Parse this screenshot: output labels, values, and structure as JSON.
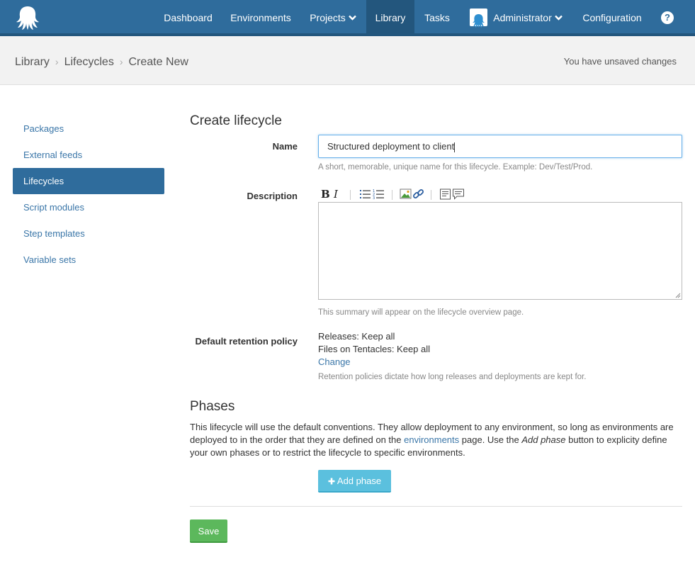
{
  "nav": {
    "items": [
      {
        "label": "Dashboard"
      },
      {
        "label": "Environments"
      },
      {
        "label": "Projects"
      },
      {
        "label": "Library"
      },
      {
        "label": "Tasks"
      },
      {
        "label": "Administrator"
      },
      {
        "label": "Configuration"
      }
    ],
    "help_label": "?"
  },
  "breadcrumb": {
    "items": [
      "Library",
      "Lifecycles",
      "Create New"
    ],
    "separator": "›",
    "status": "You have unsaved changes"
  },
  "sidebar": {
    "items": [
      {
        "label": "Packages"
      },
      {
        "label": "External feeds"
      },
      {
        "label": "Lifecycles"
      },
      {
        "label": "Script modules"
      },
      {
        "label": "Step templates"
      },
      {
        "label": "Variable sets"
      }
    ]
  },
  "form": {
    "title": "Create lifecycle",
    "name_label": "Name",
    "name_value": "Structured deployment to client",
    "name_hint": "A short, memorable, unique name for this lifecycle. Example: Dev/Test/Prod.",
    "description_label": "Description",
    "description_value": "",
    "description_hint": "This summary will appear on the lifecycle overview page.",
    "retention_label": "Default retention policy",
    "retention_releases": "Releases: Keep all",
    "retention_files": "Files on Tentacles: Keep all",
    "retention_change": "Change",
    "retention_hint": "Retention policies dictate how long releases and deployments are kept for."
  },
  "phases": {
    "title": "Phases",
    "text_1": "This lifecycle will use the default conventions. They allow deployment to any environment, so long as environments are deployed to in the order that they are defined on the ",
    "link": "environments",
    "text_2": " page. Use the ",
    "emphasis": "Add phase",
    "text_3": " button to explicity define your own phases or to restrict the lifecycle to specific environments.",
    "add_button": "Add phase"
  },
  "save_label": "Save",
  "colors": {
    "nav_bg": "#2f6c9c",
    "nav_active": "#23567d",
    "link": "#3a76a8",
    "add_button": "#5bc0de",
    "save_button": "#5cb85c"
  },
  "icons": [
    "octopus-logo-icon",
    "chevron-down-icon",
    "user-avatar-icon",
    "help-icon",
    "bold-icon",
    "italic-icon",
    "bullet-list-icon",
    "numbered-list-icon",
    "image-icon",
    "link-icon",
    "preview-icon",
    "help-markdown-icon",
    "plus-icon",
    "resize-grip-icon"
  ]
}
